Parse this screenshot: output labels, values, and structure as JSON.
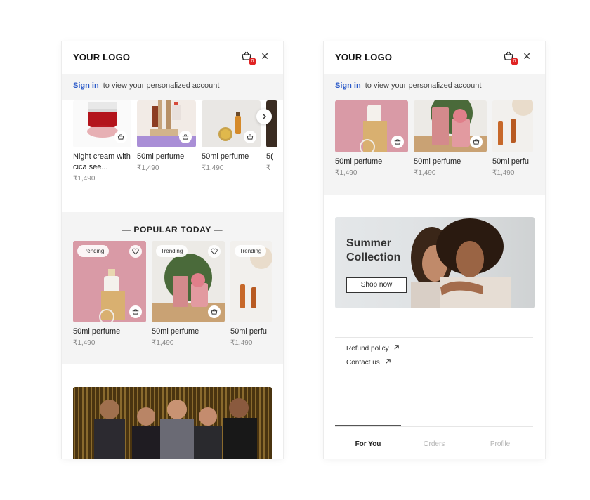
{
  "left": {
    "logo": "YOUR LOGO",
    "cart_count": "0",
    "signin": {
      "link": "Sign in",
      "text": "to view your personalized account"
    },
    "top_products": [
      {
        "name": "Night cream with cica see...",
        "price": "₹1,490"
      },
      {
        "name": "50ml perfume",
        "price": "₹1,490"
      },
      {
        "name": "50ml perfume",
        "price": "₹1,490"
      },
      {
        "name": "5(",
        "price": "₹"
      }
    ],
    "popular": {
      "title": "— POPULAR TODAY —",
      "tag": "Trending",
      "items": [
        {
          "name": "50ml perfume",
          "price": "₹1,490"
        },
        {
          "name": "50ml perfume",
          "price": "₹1,490"
        },
        {
          "name": "50ml perfu",
          "price": "₹1,490"
        }
      ]
    }
  },
  "right": {
    "logo": "YOUR LOGO",
    "cart_count": "0",
    "signin": {
      "link": "Sign in",
      "text": "to view your personalized account"
    },
    "products": [
      {
        "name": "50ml perfume",
        "price": "₹1,490"
      },
      {
        "name": "50ml perfume",
        "price": "₹1,490"
      },
      {
        "name": "50ml perfu",
        "price": "₹1,490"
      }
    ],
    "banner": {
      "title": "Summer Collection",
      "button": "Shop now"
    },
    "links": {
      "refund": "Refund policy",
      "contact": "Contact us"
    },
    "tabs": {
      "for_you": "For You",
      "orders": "Orders",
      "profile": "Profile"
    }
  },
  "colors": {
    "accent": "#2858c8",
    "badge": "#e02424",
    "section_bg": "#f4f4f4"
  }
}
